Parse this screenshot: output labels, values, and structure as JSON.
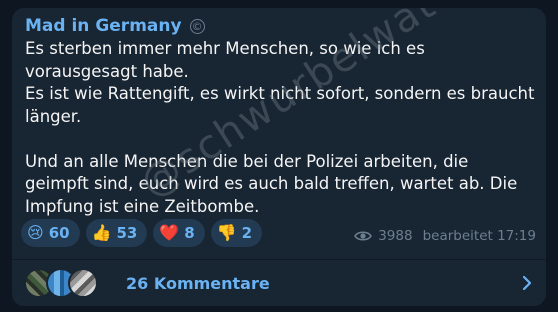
{
  "post": {
    "channel_name": "Mad in Germany",
    "message": "Es sterben immer mehr Menschen, so wie ich es vorausgesagt habe.\nEs ist wie Rattengift, es wirkt nicht sofort, sondern es braucht länger.\n\nUnd an alle Menschen die bei der Polizei arbeiten, die geimpft sind, euch wird es auch bald treffen, wartet ab. Die Impfung ist eine Zeitbombe.",
    "reactions": [
      {
        "emoji": "😢",
        "count": "60",
        "icon": "crying-face-icon"
      },
      {
        "emoji": "👍",
        "count": "53",
        "icon": "thumbs-up-icon"
      },
      {
        "emoji": "❤️",
        "count": "8",
        "icon": "heart-icon"
      },
      {
        "emoji": "👎",
        "count": "2",
        "icon": "thumbs-down-icon"
      }
    ],
    "views": "3988",
    "edited_time": "bearbeitet 17:19",
    "comments_label": "26 Kommentare"
  },
  "watermark": "@schwurbelwatch",
  "colors": {
    "background": "#0e1621",
    "bubble": "#182533",
    "accent": "#6ab2f2",
    "reaction_bg": "#223a52",
    "muted": "#6d7f8f"
  }
}
